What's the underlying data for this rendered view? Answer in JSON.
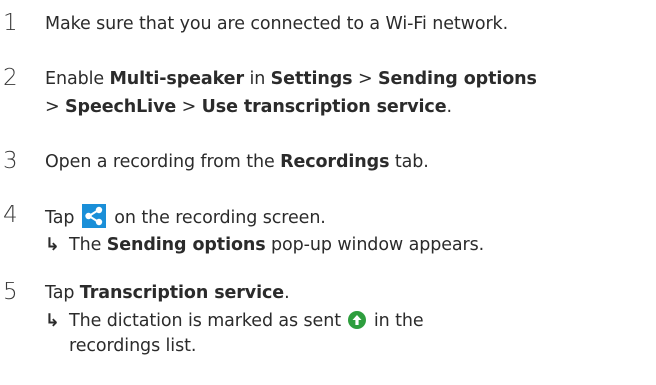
{
  "steps": [
    {
      "number": "1",
      "lines": [
        [
          {
            "text": "Make sure that you are connected to a Wi-Fi network.",
            "bold": false
          }
        ]
      ]
    },
    {
      "number": "2",
      "lines": [
        [
          {
            "text": "Enable ",
            "bold": false
          },
          {
            "text": "Multi-speaker",
            "bold": true
          },
          {
            "text": " in ",
            "bold": false
          },
          {
            "text": "Settings",
            "bold": true
          },
          {
            "text": " > ",
            "bold": false
          },
          {
            "text": "Sending options",
            "bold": true
          }
        ],
        [
          {
            "text": "> ",
            "bold": false
          },
          {
            "text": "SpeechLive",
            "bold": true
          },
          {
            "text": " > ",
            "bold": false
          },
          {
            "text": "Use transcription service",
            "bold": true
          },
          {
            "text": ".",
            "bold": false
          }
        ]
      ]
    },
    {
      "number": "3",
      "lines": [
        [
          {
            "text": "Open a recording from the ",
            "bold": false
          },
          {
            "text": "Recordings",
            "bold": true
          },
          {
            "text": " tab.",
            "bold": false
          }
        ]
      ]
    },
    {
      "number": "4",
      "line_before_icon": "Tap",
      "icon": "share-icon",
      "line_after_icon": "on the recording screen.",
      "result_lines": [
        [
          {
            "text": "The ",
            "bold": false
          },
          {
            "text": "Sending options",
            "bold": true
          },
          {
            "text": " pop-up window appears.",
            "bold": false
          }
        ]
      ]
    },
    {
      "number": "5",
      "lines": [
        [
          {
            "text": "Tap ",
            "bold": false
          },
          {
            "text": "Transcription service",
            "bold": true
          },
          {
            "text": ".",
            "bold": false
          }
        ]
      ],
      "result_before_icon": "The dictation is marked as sent",
      "result_icon": "sent-arrow-icon",
      "result_after_icon": "in the",
      "result_continuation": "recordings list."
    }
  ],
  "arrow_symbol": "↳",
  "colors": {
    "text": "#2b2b2b",
    "share_icon_bg": "#1a8fd8",
    "sent_icon": "#2e9e3e"
  }
}
